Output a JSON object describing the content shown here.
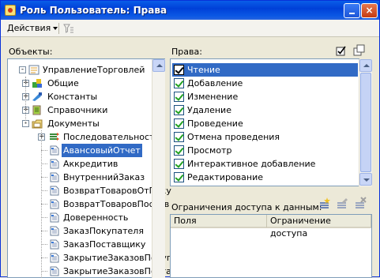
{
  "window": {
    "title": "Роль Пользователь: Права",
    "minimize_label": "",
    "close_label": "×"
  },
  "toolbar": {
    "actions_label": "Действия",
    "filter_icon": "filter-icon"
  },
  "objects_panel": {
    "label": "Объекты:",
    "tree": [
      {
        "label": "УправлениеТорговлей",
        "level": 0,
        "icon": "config-icon",
        "expander": "-"
      },
      {
        "label": "Общие",
        "level": 1,
        "icon": "common-icon",
        "expander": "+"
      },
      {
        "label": "Константы",
        "level": 1,
        "icon": "constants-icon",
        "expander": "+"
      },
      {
        "label": "Справочники",
        "level": 1,
        "icon": "catalogs-icon",
        "expander": "+"
      },
      {
        "label": "Документы",
        "level": 1,
        "icon": "documents-icon",
        "expander": "-"
      },
      {
        "label": "Последовательности",
        "level": 2,
        "icon": "sequence-icon",
        "expander": "+"
      },
      {
        "label": "АвансовыйОтчет",
        "level": 2,
        "icon": "document-icon",
        "expander": "",
        "selected": true
      },
      {
        "label": "Аккредитив",
        "level": 2,
        "icon": "document-icon",
        "expander": ""
      },
      {
        "label": "ВнутреннийЗаказ",
        "level": 2,
        "icon": "document-icon",
        "expander": ""
      },
      {
        "label": "ВозвратТоваровОтПоку",
        "level": 2,
        "icon": "document-icon",
        "expander": ""
      },
      {
        "label": "ВозвратТоваровПостав",
        "level": 2,
        "icon": "document-icon",
        "expander": ""
      },
      {
        "label": "Доверенность",
        "level": 2,
        "icon": "document-icon",
        "expander": ""
      },
      {
        "label": "ЗаказПокупателя",
        "level": 2,
        "icon": "document-icon",
        "expander": ""
      },
      {
        "label": "ЗаказПоставщику",
        "level": 2,
        "icon": "document-icon",
        "expander": ""
      },
      {
        "label": "ЗакрытиеЗаказовПокуп",
        "level": 2,
        "icon": "document-icon",
        "expander": ""
      },
      {
        "label": "ЗакрытиеЗаказовПоста",
        "level": 2,
        "icon": "document-icon",
        "expander": ""
      }
    ]
  },
  "rights_panel": {
    "label": "Права:",
    "icons": [
      "check-all-icon",
      "uncheck-all-icon"
    ],
    "items": [
      {
        "label": "Чтение",
        "checked": true,
        "selected": true
      },
      {
        "label": "Добавление",
        "checked": true
      },
      {
        "label": "Изменение",
        "checked": true
      },
      {
        "label": "Удаление",
        "checked": true
      },
      {
        "label": "Проведение",
        "checked": true
      },
      {
        "label": "Отмена проведения",
        "checked": true
      },
      {
        "label": "Просмотр",
        "checked": true
      },
      {
        "label": "Интерактивное добавление",
        "checked": true
      },
      {
        "label": "Редактирование",
        "checked": true
      }
    ]
  },
  "restrictions_panel": {
    "label": "Ограничения доступа к данным:",
    "icons": [
      "add-row-icon",
      "edit-row-icon",
      "delete-row-icon"
    ],
    "columns": [
      "Поля",
      "Ограничение доступа"
    ]
  },
  "colors": {
    "titlebar": "#0054e3",
    "selection": "#316ac5",
    "window_bg": "#ece9d8"
  }
}
